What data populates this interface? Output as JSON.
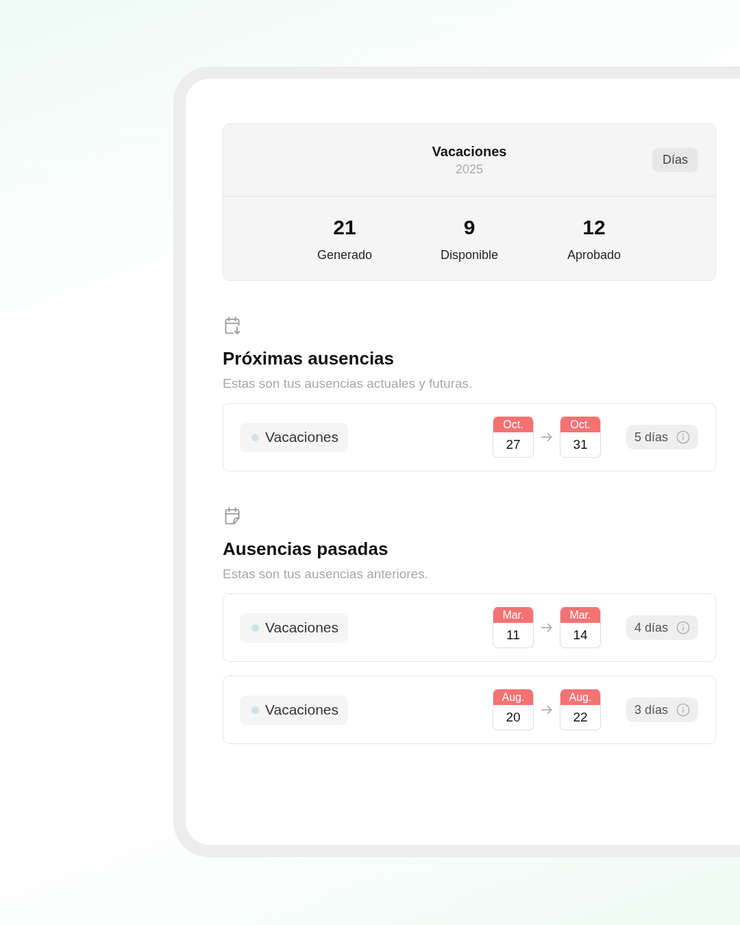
{
  "summary": {
    "title": "Vacaciones",
    "year": "2025",
    "unit_button": "Días",
    "stats": [
      {
        "value": "21",
        "label": "Generado"
      },
      {
        "value": "9",
        "label": "Disponible"
      },
      {
        "value": "12",
        "label": "Aprobado"
      }
    ]
  },
  "sections": [
    {
      "kind": "upcoming",
      "title": "Próximas ausencias",
      "subtitle": "Estas son tus ausencias actuales y futuras.",
      "absences": [
        {
          "type": "Vacaciones",
          "start": {
            "month": "Oct.",
            "day": "27"
          },
          "end": {
            "month": "Oct.",
            "day": "31"
          },
          "duration": "5 días"
        }
      ]
    },
    {
      "kind": "past",
      "title": "Ausencias pasadas",
      "subtitle": "Estas son tus ausencias anteriores.",
      "absences": [
        {
          "type": "Vacaciones",
          "start": {
            "month": "Mar.",
            "day": "11"
          },
          "end": {
            "month": "Mar.",
            "day": "14"
          },
          "duration": "4 días"
        },
        {
          "type": "Vacaciones",
          "start": {
            "month": "Aug.",
            "day": "20"
          },
          "end": {
            "month": "Aug.",
            "day": "22"
          },
          "duration": "3 días"
        }
      ]
    }
  ]
}
